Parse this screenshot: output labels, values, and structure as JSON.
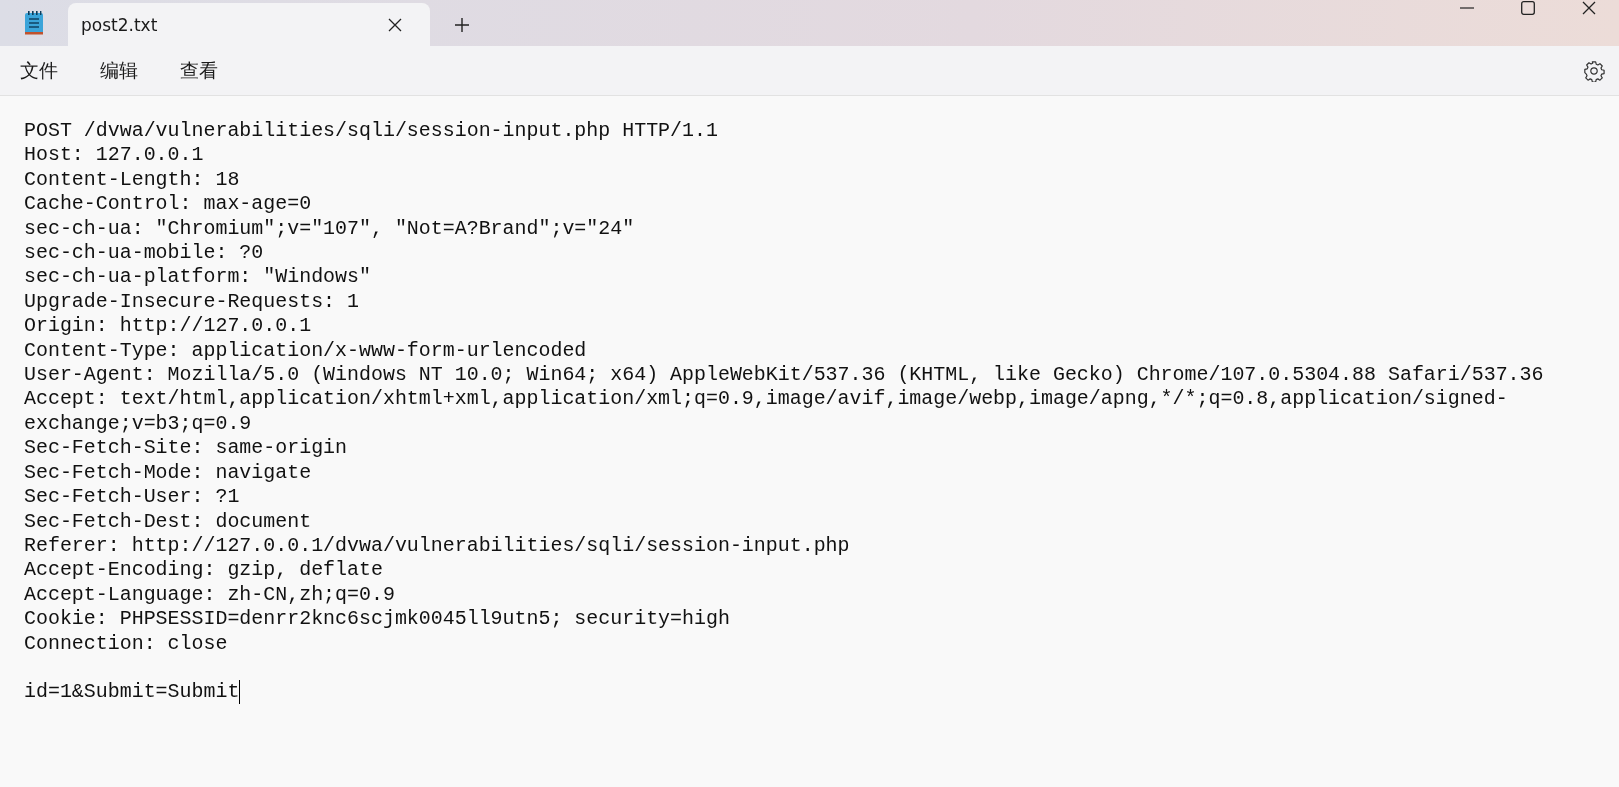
{
  "tabs": [
    {
      "label": "post2.txt",
      "selected": true
    }
  ],
  "menu": [
    {
      "label": "文件"
    },
    {
      "label": "编辑"
    },
    {
      "label": "查看"
    }
  ],
  "editor": {
    "headers": [
      "POST /dvwa/vulnerabilities/sqli/session-input.php HTTP/1.1",
      "Host: 127.0.0.1",
      "Content-Length: 18",
      "Cache-Control: max-age=0",
      "sec-ch-ua: \"Chromium\";v=\"107\", \"Not=A?Brand\";v=\"24\"",
      "sec-ch-ua-mobile: ?0",
      "sec-ch-ua-platform: \"Windows\"",
      "Upgrade-Insecure-Requests: 1",
      "Origin: http://127.0.0.1",
      "Content-Type: application/x-www-form-urlencoded",
      "User-Agent: Mozilla/5.0 (Windows NT 10.0; Win64; x64) AppleWebKit/537.36 (KHTML, like Gecko) Chrome/107.0.5304.88 Safari/537.36",
      "Accept: text/html,application/xhtml+xml,application/xml;q=0.9,image/avif,image/webp,image/apng,*/*;q=0.8,application/signed-",
      "exchange;v=b3;q=0.9",
      "Sec-Fetch-Site: same-origin",
      "Sec-Fetch-Mode: navigate",
      "Sec-Fetch-User: ?1",
      "Sec-Fetch-Dest: document",
      "Referer: http://127.0.0.1/dvwa/vulnerabilities/sqli/session-input.php",
      "Accept-Encoding: gzip, deflate",
      "Accept-Language: zh-CN,zh;q=0.9",
      "Cookie: PHPSESSID=denrr2knc6scjmk0045ll9utn5; security=high",
      "Connection: close"
    ],
    "body": [
      "id=1&Submit=Submit"
    ],
    "caret_visible": true
  }
}
